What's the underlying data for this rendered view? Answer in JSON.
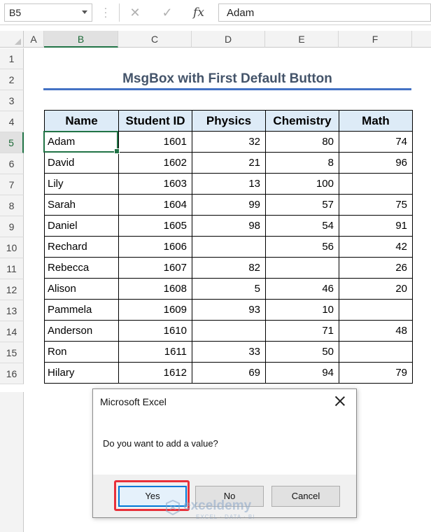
{
  "formula_bar": {
    "name_box": "B5",
    "cancel_icon": "close-icon",
    "enter_icon": "checkmark-icon",
    "fx_label": "fx",
    "content": "Adam"
  },
  "columns": [
    "A",
    "B",
    "C",
    "D",
    "E",
    "F"
  ],
  "selected_column": "B",
  "rows": [
    "1",
    "2",
    "3",
    "4",
    "5",
    "6",
    "7",
    "8",
    "9",
    "10",
    "11",
    "12",
    "13",
    "14",
    "15",
    "16"
  ],
  "selected_row": "5",
  "sheet": {
    "title": "MsgBox with First Default Button",
    "headers": [
      "Name",
      "Student ID",
      "Physics",
      "Chemistry",
      "Math"
    ],
    "records": [
      [
        "Adam",
        "1601",
        "32",
        "80",
        "74"
      ],
      [
        "David",
        "1602",
        "21",
        "8",
        "96"
      ],
      [
        "Lily",
        "1603",
        "13",
        "100",
        ""
      ],
      [
        "Sarah",
        "1604",
        "99",
        "57",
        "75"
      ],
      [
        "Daniel",
        "1605",
        "98",
        "54",
        "91"
      ],
      [
        "Rechard",
        "1606",
        "",
        "56",
        "42"
      ],
      [
        "Rebecca",
        "1607",
        "82",
        "",
        "26"
      ],
      [
        "Alison",
        "1608",
        "5",
        "46",
        "20"
      ],
      [
        "Pammela",
        "1609",
        "93",
        "10",
        ""
      ],
      [
        "Anderson",
        "1610",
        "",
        "71",
        "48"
      ],
      [
        "Ron",
        "1611",
        "33",
        "50",
        ""
      ],
      [
        "Hilary",
        "1612",
        "69",
        "94",
        "79"
      ]
    ]
  },
  "dialog": {
    "title": "Microsoft Excel",
    "message": "Do you want to add a value?",
    "buttons": {
      "yes": "Yes",
      "no": "No",
      "cancel": "Cancel"
    },
    "default_button": "Yes"
  },
  "watermark": {
    "brand": "exceldemy",
    "tagline": "EXCEL · DATA · BI"
  },
  "colors": {
    "accent_green": "#217346",
    "header_fill": "#ddebf7",
    "title_text": "#44546a",
    "title_underline": "#4472c4",
    "highlight_red": "#e8303a"
  }
}
